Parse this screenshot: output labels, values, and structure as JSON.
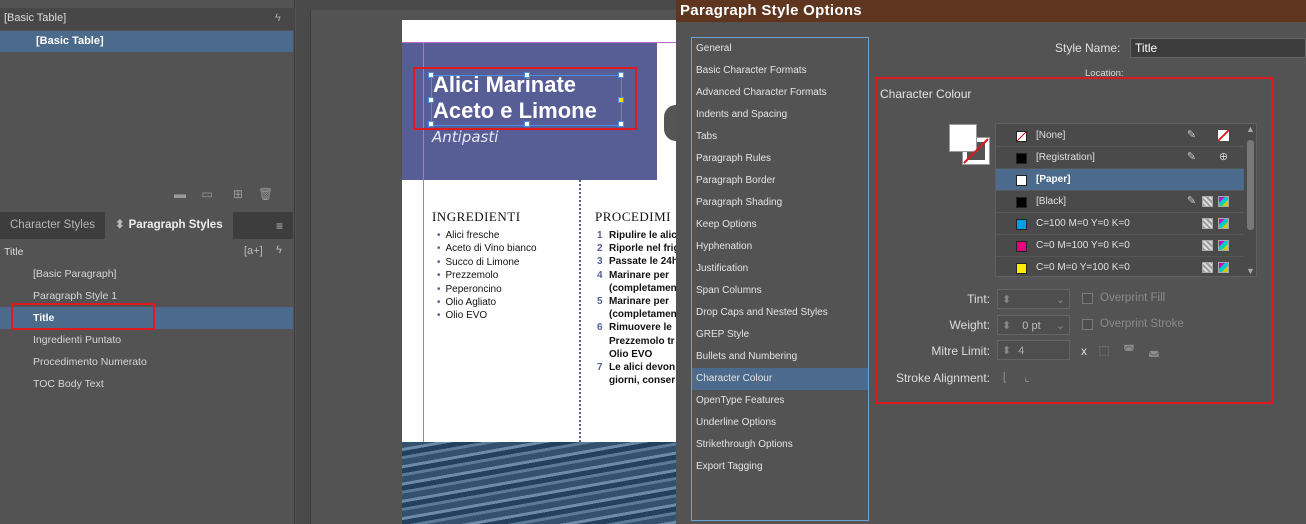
{
  "left_panel": {
    "table_styles_header": "[Basic Table]",
    "table_styles_selected": "[Basic Table]",
    "tabs": {
      "character_styles": "Character Styles",
      "paragraph_styles": "Paragraph Styles"
    },
    "current_style": "Title",
    "new_from_selection": "[a+]",
    "paragraph_styles": [
      "[Basic Paragraph]",
      "Paragraph Style 1",
      "Title",
      "Ingredienti Puntato",
      "Procedimento Numerato",
      "TOC Body Text"
    ],
    "selected_index": 2
  },
  "document": {
    "title_line1": "Alici Marinate",
    "title_line2": "Aceto e Limone",
    "subtitle": "Antipasti",
    "ingredients_heading": "INGREDIENTI",
    "ingredients": [
      "Alici fresche",
      "Aceto di Vino bianco",
      "Succo di Limone",
      "Prezzemolo",
      "Peperoncino",
      "Olio Agliato",
      "Olio EVO"
    ],
    "procedure_heading": "PROCEDIMI",
    "procedure_lines": [
      {
        "num": "1",
        "text": "Ripulire le alic"
      },
      {
        "num": "2",
        "text": "Riporle nel frig"
      },
      {
        "num": "3",
        "text": "Passate le 24h"
      },
      {
        "num": "4",
        "text": "Marinare per"
      },
      {
        "num": "",
        "text": "(completamen"
      },
      {
        "num": "5",
        "text": "Marinare per"
      },
      {
        "num": "",
        "text": "(completamen"
      },
      {
        "num": "6",
        "text": "Rimuovere le"
      },
      {
        "num": "",
        "text": "Prezzemolo tr"
      },
      {
        "num": "",
        "text": "Olio EVO"
      },
      {
        "num": "7",
        "text": "Le alici devon"
      },
      {
        "num": "",
        "text": "giorni, conser"
      }
    ]
  },
  "dialog": {
    "title": "Paragraph Style Options",
    "categories": [
      "General",
      "Basic Character Formats",
      "Advanced Character Formats",
      "Indents and Spacing",
      "Tabs",
      "Paragraph Rules",
      "Paragraph Border",
      "Paragraph Shading",
      "Keep Options",
      "Hyphenation",
      "Justification",
      "Span Columns",
      "Drop Caps and Nested Styles",
      "GREP Style",
      "Bullets and Numbering",
      "Character Colour",
      "OpenType Features",
      "Underline Options",
      "Strikethrough Options",
      "Export Tagging"
    ],
    "selected_category_index": 15,
    "style_name_label": "Style Name:",
    "style_name_value": "Title",
    "location_label": "Location:",
    "section_title": "Character Colour",
    "swatches": [
      {
        "name": "[None]",
        "color": "none"
      },
      {
        "name": "[Registration]",
        "color": "#000000"
      },
      {
        "name": "[Paper]",
        "color": "#ffffff"
      },
      {
        "name": "[Black]",
        "color": "#000000"
      },
      {
        "name": "C=100 M=0 Y=0 K=0",
        "color": "#009fe3"
      },
      {
        "name": "C=0 M=100 Y=0 K=0",
        "color": "#e6007e"
      },
      {
        "name": "C=0 M=0 Y=100 K=0",
        "color": "#ffed00"
      }
    ],
    "selected_swatch_index": 2,
    "tint_label": "Tint:",
    "tint_value": "",
    "overprint_fill_label": "Overprint Fill",
    "weight_label": "Weight:",
    "weight_value": "0 pt",
    "overprint_stroke_label": "Overprint Stroke",
    "mitre_label": "Mitre Limit:",
    "mitre_value": "4",
    "mitre_x": "x",
    "stroke_alignment_label": "Stroke Alignment:"
  },
  "colors": {
    "selection": "#4c6a8b",
    "highlight_box": "#e0181f",
    "banner": "#575e96",
    "dialog_title_bar": "#5e3620"
  }
}
